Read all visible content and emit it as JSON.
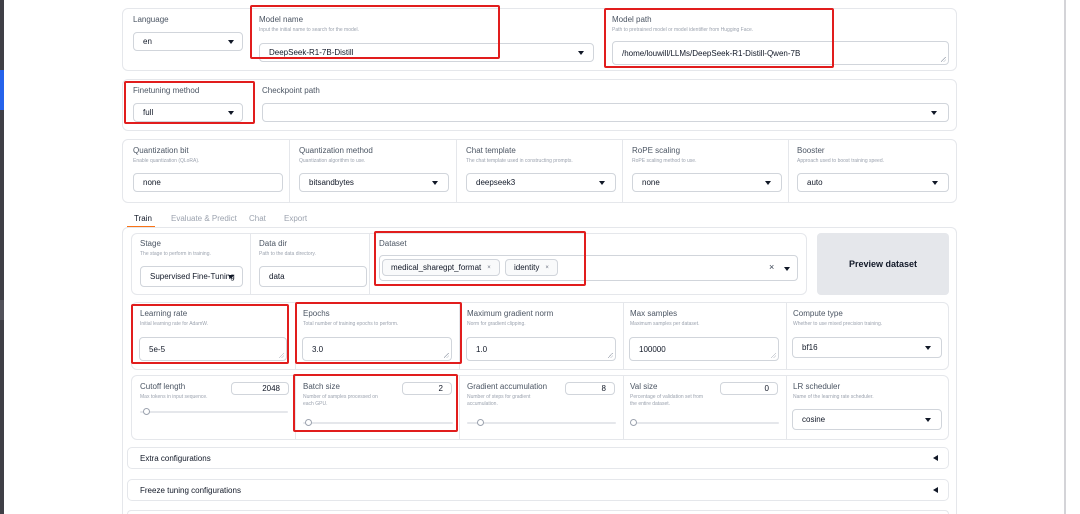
{
  "top": {
    "language": {
      "label": "Language",
      "value": "en"
    },
    "model_name": {
      "label": "Model name",
      "info": "Input the initial name to search for the model.",
      "value": "DeepSeek-R1-7B-Distill"
    },
    "model_path": {
      "label": "Model path",
      "info": "Path to pretrained model or model identifier from Hugging Face.",
      "value": "/home/louwill/LLMs/DeepSeek-R1-Distill-Qwen-7B"
    }
  },
  "row2": {
    "finetuning": {
      "label": "Finetuning method",
      "value": "full"
    },
    "checkpoint": {
      "label": "Checkpoint path",
      "value": ""
    }
  },
  "row3": {
    "quant_bit": {
      "label": "Quantization bit",
      "info": "Enable quantization (QLoRA).",
      "value": "none"
    },
    "quant_method": {
      "label": "Quantization method",
      "info": "Quantization algorithm to use.",
      "value": "bitsandbytes"
    },
    "chat_template": {
      "label": "Chat template",
      "info": "The chat template used in constructing prompts.",
      "value": "deepseek3"
    },
    "rope": {
      "label": "RoPE scaling",
      "info": "RoPE scaling method to use.",
      "value": "none"
    },
    "booster": {
      "label": "Booster",
      "info": "Approach used to boost training speed.",
      "value": "auto"
    }
  },
  "tabs": [
    "Train",
    "Evaluate & Predict",
    "Chat",
    "Export"
  ],
  "train": {
    "stage": {
      "label": "Stage",
      "info": "The stage to perform in training.",
      "value": "Supervised Fine-Tuning"
    },
    "data_dir": {
      "label": "Data dir",
      "info": "Path to the data directory.",
      "value": "data"
    },
    "dataset": {
      "label": "Dataset",
      "chips": [
        "medical_sharegpt_format",
        "identity"
      ],
      "clear": "×",
      "chip_remove": "×"
    },
    "preview_button": "Preview dataset",
    "learning_rate": {
      "label": "Learning rate",
      "info": "Initial learning rate for AdamW.",
      "value": "5e-5"
    },
    "epochs": {
      "label": "Epochs",
      "info": "Total number of training epochs to perform.",
      "value": "3.0"
    },
    "max_grad_norm": {
      "label": "Maximum gradient norm",
      "info": "Norm for gradient clipping.",
      "value": "1.0"
    },
    "max_samples": {
      "label": "Max samples",
      "info": "Maximum samples per dataset.",
      "value": "100000"
    },
    "compute_type": {
      "label": "Compute type",
      "info": "Whether to use mixed precision training.",
      "value": "bf16"
    },
    "cutoff_len": {
      "label": "Cutoff length",
      "info": "Max tokens in input sequence.",
      "value": "2048",
      "slider_fraction": 0.02
    },
    "batch_size": {
      "label": "Batch size",
      "info_line1": "Number of samples processed on",
      "info_line2": "each GPU.",
      "value": "2",
      "slider_fraction": 0.01
    },
    "grad_accum": {
      "label": "Gradient accumulation",
      "info_line1": "Number of steps for gradient",
      "info_line2": "accumulation.",
      "value": "8",
      "slider_fraction": 0.07
    },
    "val_size": {
      "label": "Val size",
      "info_line1": "Percentage of validation set from",
      "info_line2": "the entire dataset.",
      "value": "0",
      "slider_fraction": 0.0
    },
    "lr_scheduler": {
      "label": "LR scheduler",
      "info": "Name of the learning rate scheduler.",
      "value": "cosine"
    }
  },
  "accordions": {
    "extra": "Extra configurations",
    "freeze": "Freeze tuning configurations"
  },
  "colors": {
    "highlight": "#e11d1d",
    "tab_active": "#f97316"
  }
}
